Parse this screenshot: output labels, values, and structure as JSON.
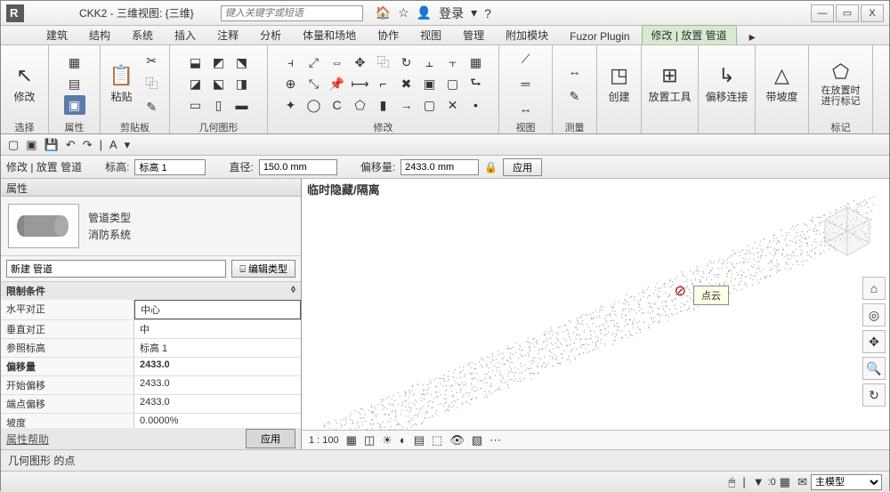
{
  "titlebar": {
    "title": "CKK2 - 三维视图: {三维}",
    "search_placeholder": "键入关键字或短语",
    "login_label": "登录"
  },
  "win": {
    "min": "—",
    "max": "▭",
    "close": "X"
  },
  "tabs": {
    "items": [
      "建筑",
      "结构",
      "系统",
      "插入",
      "注释",
      "分析",
      "体量和场地",
      "协作",
      "视图",
      "管理",
      "附加模块",
      "Fuzor Plugin"
    ],
    "active": "修改 | 放置 管道",
    "video_icon": "▸"
  },
  "ribbon": {
    "select": {
      "label": "选择",
      "modify": "修改"
    },
    "props": {
      "label": "属性"
    },
    "clip": {
      "label": "剪贴板",
      "paste": "粘贴"
    },
    "geom": {
      "label": "几何图形"
    },
    "modify": {
      "label": "修改"
    },
    "view": {
      "label": "视图"
    },
    "measure": {
      "label": "测量"
    },
    "create": {
      "label": "",
      "btn": "创建"
    },
    "place": {
      "label": "",
      "btn": "放置工具"
    },
    "offset": {
      "label": "",
      "btn": "偏移连接"
    },
    "slope": {
      "label": "",
      "btn": "带坡度"
    },
    "tag": {
      "label": "标记",
      "btn": "在放置时\n进行标记"
    }
  },
  "options": {
    "context": "修改 | 放置 管道",
    "level_label": "标高:",
    "level_value": "标高 1",
    "dia_label": "直径:",
    "dia_value": "150.0 mm",
    "offset_label": "偏移量:",
    "offset_value": "2433.0 mm",
    "apply": "应用"
  },
  "props": {
    "title": "属性",
    "type_cat": "管道类型",
    "type_name": "消防系统",
    "instance": "新建 管道",
    "edit_type": "⌸ 编辑类型",
    "cat": "限制条件",
    "rows": [
      {
        "k": "水平对正",
        "v": "中心",
        "boxed": true
      },
      {
        "k": "垂直对正",
        "v": "中"
      },
      {
        "k": "参照标高",
        "v": "标高 1"
      },
      {
        "k": "偏移量",
        "v": "2433.0",
        "bold": true
      },
      {
        "k": "开始偏移",
        "v": "2433.0"
      },
      {
        "k": "端点偏移",
        "v": "2433.0"
      },
      {
        "k": "坡度",
        "v": "0.0000%"
      }
    ],
    "help": "属性帮助",
    "apply": "应用"
  },
  "viewport": {
    "title": "临时隐藏/隔离",
    "tooltip": "点云",
    "scale": "1 : 100"
  },
  "status": {
    "geom": "几何图形 的点",
    "zero": ":0",
    "model": "主模型"
  }
}
